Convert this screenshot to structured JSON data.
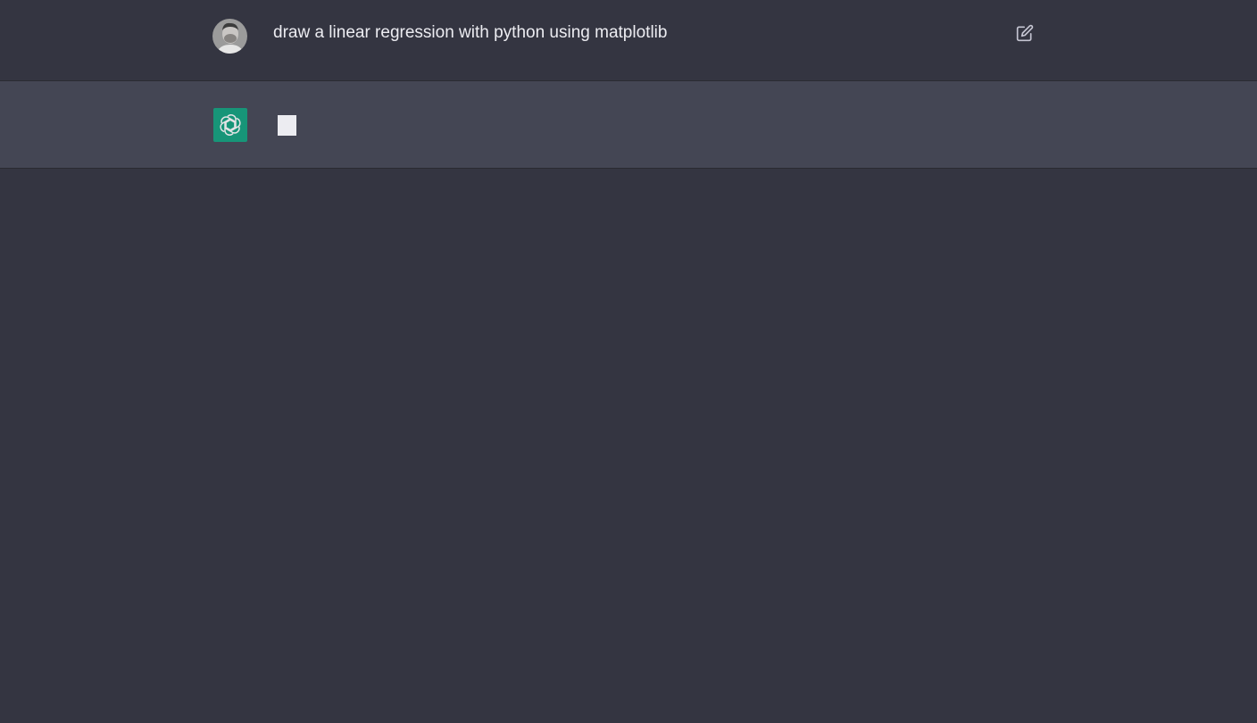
{
  "conversation": {
    "user_message": {
      "text": "draw a linear regression with python using matplotlib",
      "avatar_icon": "user-avatar",
      "edit_icon": "edit-icon"
    },
    "assistant_message": {
      "avatar_icon": "openai-logo-icon",
      "state": "typing"
    }
  },
  "colors": {
    "background": "#343541",
    "assistant_row": "#444654",
    "text": "#ececf1",
    "brand": "#10a37f"
  }
}
